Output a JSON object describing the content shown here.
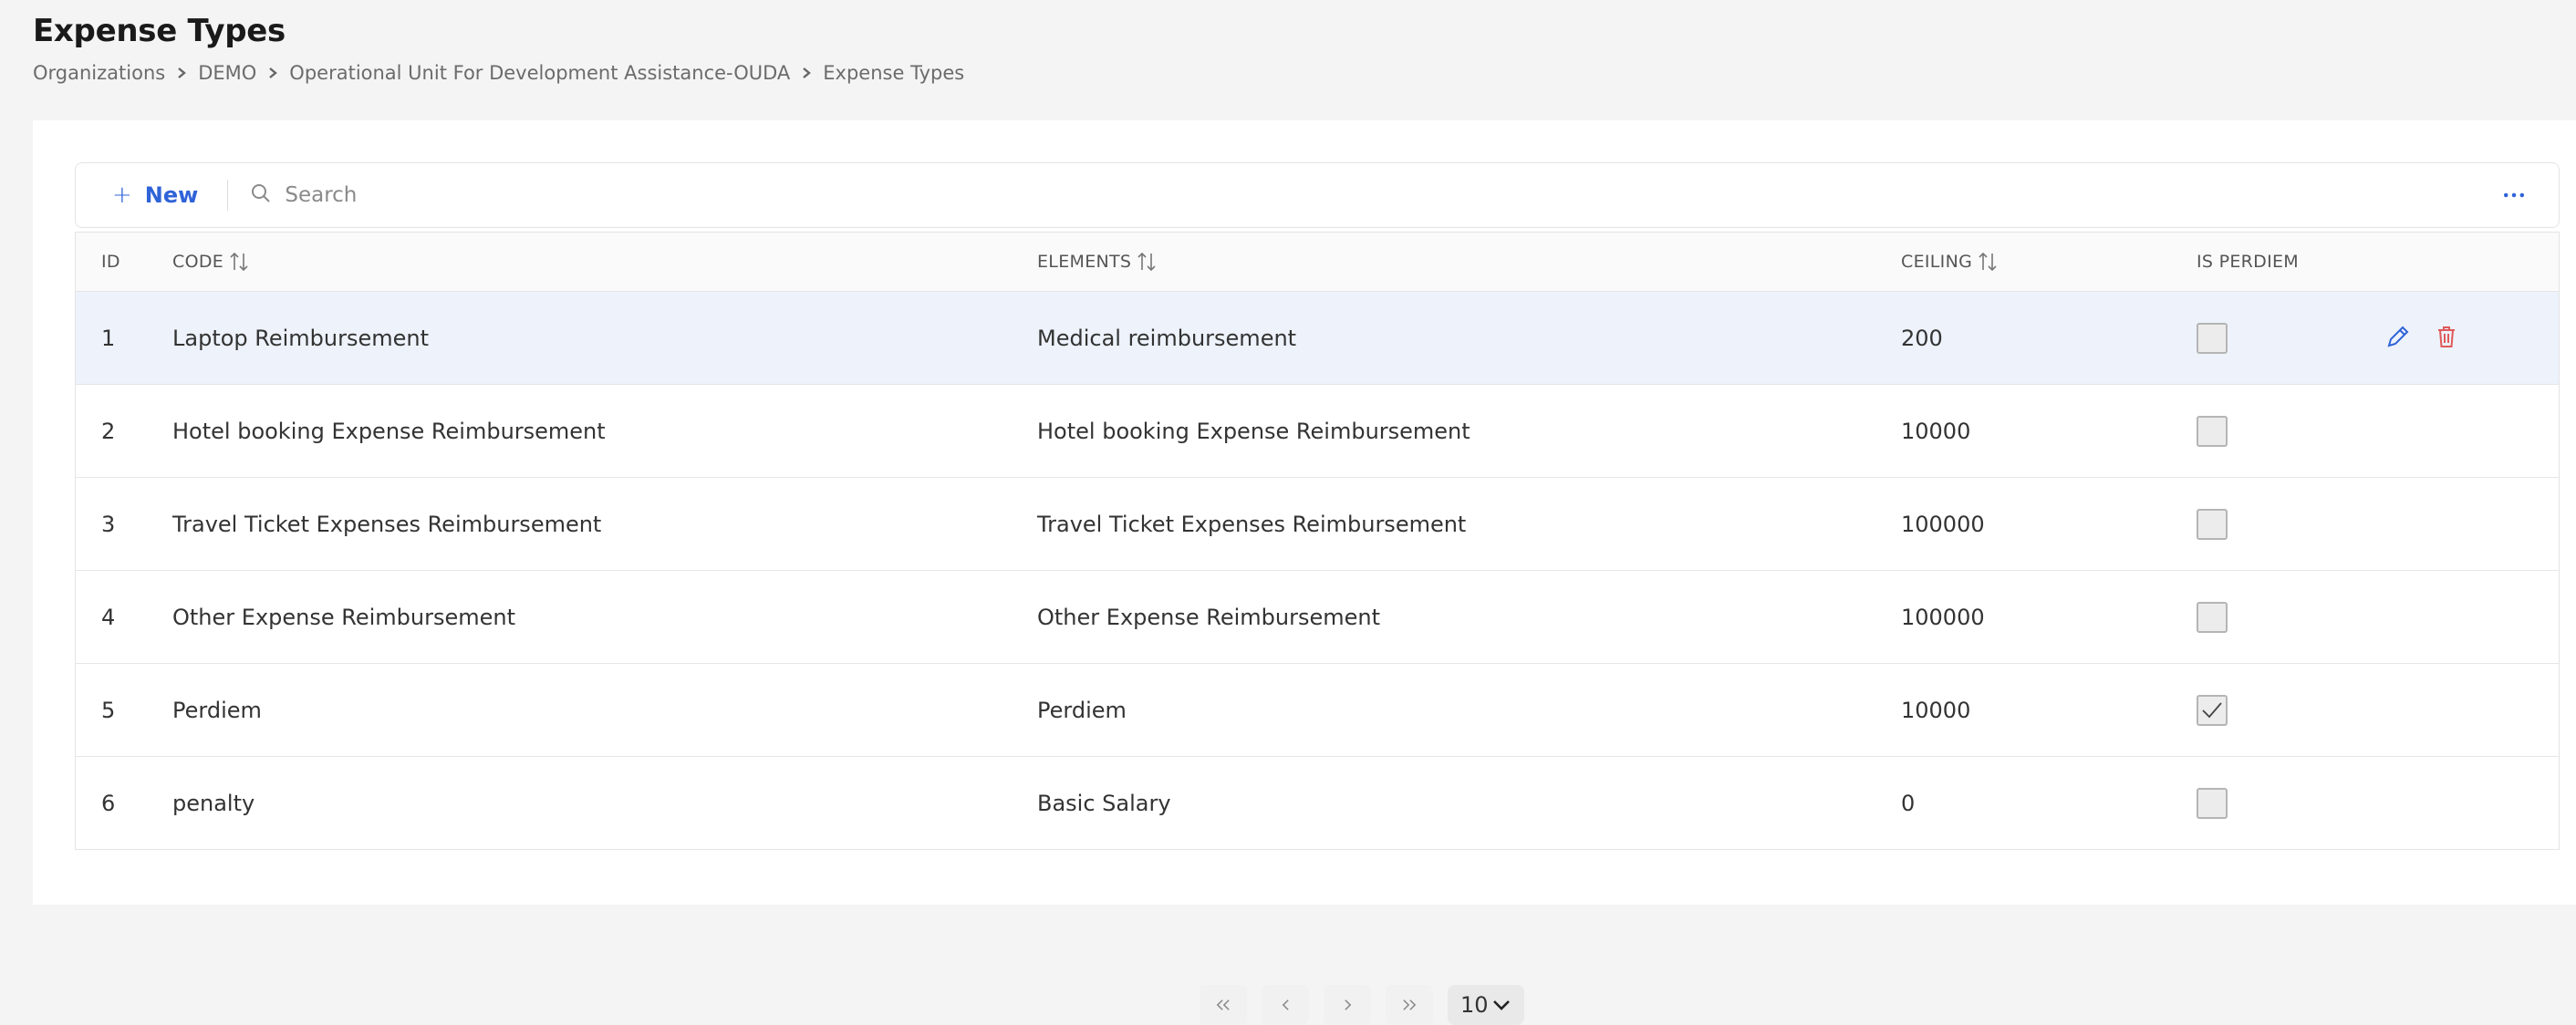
{
  "page": {
    "title": "Expense Types",
    "breadcrumb": [
      "Organizations",
      "DEMO",
      "Operational Unit For Development Assistance-OUDA",
      "Expense Types"
    ]
  },
  "toolbar": {
    "new_label": "New",
    "search_placeholder": "Search",
    "more_icon": "ellipsis-icon"
  },
  "table": {
    "columns": [
      {
        "label": "ID",
        "sortable": false
      },
      {
        "label": "CODE",
        "sortable": true
      },
      {
        "label": "ELEMENTS",
        "sortable": true
      },
      {
        "label": "CEILING",
        "sortable": true
      },
      {
        "label": "IS PERDIEM",
        "sortable": false
      }
    ],
    "rows": [
      {
        "id": "1",
        "code": "Laptop Reimbursement",
        "elements": "Medical reimbursement",
        "ceiling": "200",
        "is_perdiem": false
      },
      {
        "id": "2",
        "code": "Hotel booking Expense Reimbursement",
        "elements": "Hotel booking Expense Reimbursement",
        "ceiling": "10000",
        "is_perdiem": false
      },
      {
        "id": "3",
        "code": "Travel Ticket Expenses Reimbursement",
        "elements": "Travel Ticket Expenses Reimbursement",
        "ceiling": "100000",
        "is_perdiem": false
      },
      {
        "id": "4",
        "code": "Other Expense Reimbursement",
        "elements": "Other Expense Reimbursement",
        "ceiling": "100000",
        "is_perdiem": false
      },
      {
        "id": "5",
        "code": "Perdiem",
        "elements": "Perdiem",
        "ceiling": "10000",
        "is_perdiem": true
      },
      {
        "id": "6",
        "code": "penalty",
        "elements": "Basic Salary",
        "ceiling": "0",
        "is_perdiem": false
      }
    ],
    "selected_row": 0
  },
  "pagination": {
    "page_size": "10"
  },
  "colors": {
    "accent": "#2f63d8",
    "delete": "#e05a5a",
    "selected_row_bg": "#edf2fb"
  }
}
